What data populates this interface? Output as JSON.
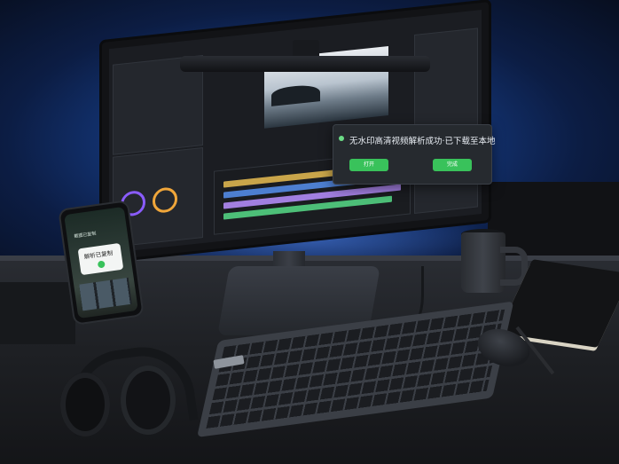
{
  "scene": {
    "description_hidden": false
  },
  "monitor": {
    "notification": {
      "message": "无水印高清视频解析成功·已下载至本地",
      "buttons": [
        "打开",
        "完成"
      ]
    }
  },
  "phone": {
    "header": "截图已复制",
    "card_text": "解析已复制"
  },
  "colors": {
    "wall_blue": "#1d4fa8",
    "accent_green": "#39c25b",
    "desk": "#1e2024"
  }
}
